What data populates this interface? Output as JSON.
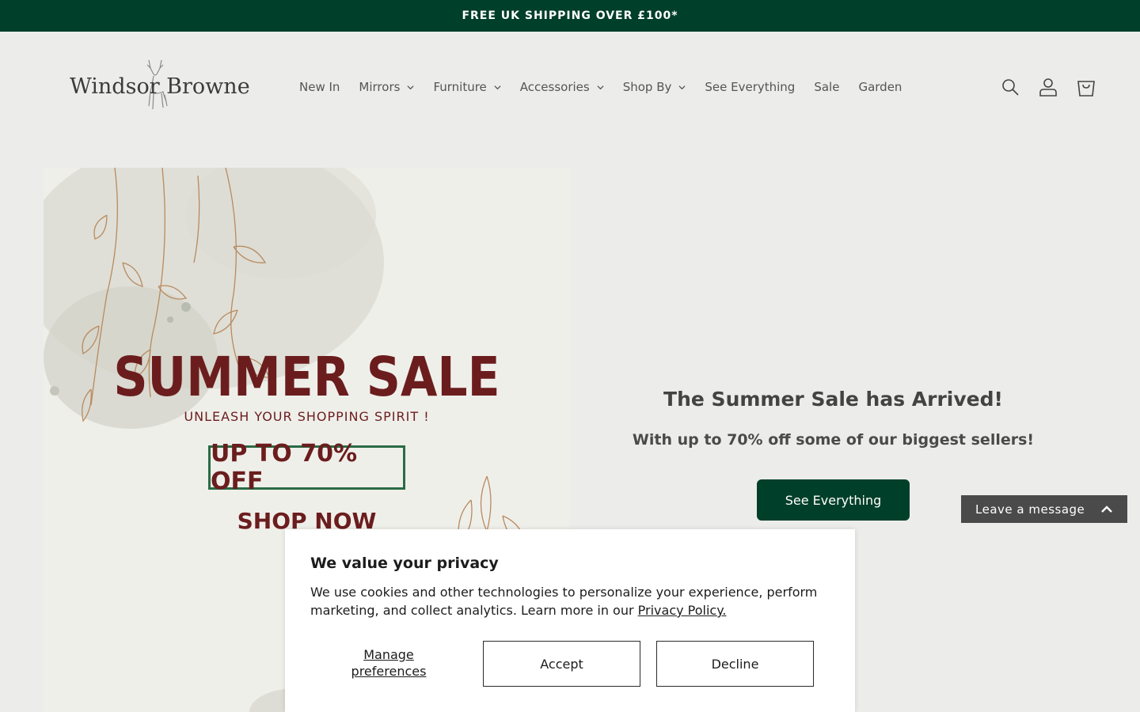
{
  "announcement": {
    "text": "FREE UK SHIPPING OVER £100*"
  },
  "header": {
    "logo_text": "Windsor Browne",
    "nav": [
      {
        "label": "New In",
        "has_dropdown": false
      },
      {
        "label": "Mirrors",
        "has_dropdown": true
      },
      {
        "label": "Furniture",
        "has_dropdown": true
      },
      {
        "label": "Accessories",
        "has_dropdown": true
      },
      {
        "label": "Shop By",
        "has_dropdown": true
      },
      {
        "label": "See Everything",
        "has_dropdown": false
      },
      {
        "label": "Sale",
        "has_dropdown": false
      },
      {
        "label": "Garden",
        "has_dropdown": false
      }
    ],
    "icons": [
      "search-icon",
      "account-icon",
      "cart-icon"
    ]
  },
  "hero": {
    "image": {
      "title": "SUMMER SALE",
      "subtitle": "UNLEASH YOUR SHOPPING SPIRIT !",
      "offer": "UP TO 70% OFF",
      "cta": "SHOP NOW"
    },
    "heading": "The Summer Sale has Arrived!",
    "subheading": "With up to 70% off some of our biggest sellers!",
    "button_label": "See Everything"
  },
  "chat": {
    "label": "Leave a message"
  },
  "cookie_banner": {
    "title": "We value your privacy",
    "text": "We use cookies and other technologies to personalize your experience, perform marketing, and collect analytics. Learn more in our ",
    "link_text": "Privacy Policy.",
    "manage_label": "Manage preferences",
    "accept_label": "Accept",
    "decline_label": "Decline"
  },
  "colors": {
    "brand_green": "#003f2a",
    "sale_red": "#6b1d1d",
    "background": "#ececeb"
  }
}
